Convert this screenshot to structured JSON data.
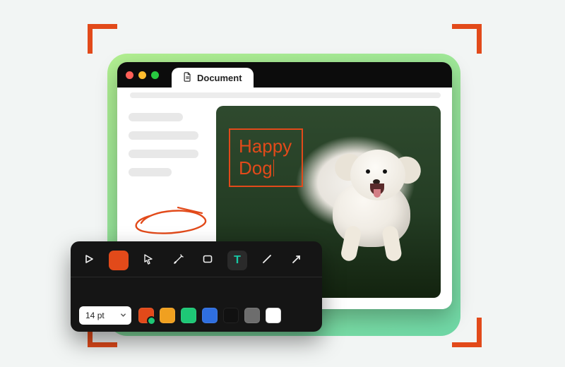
{
  "capture_corner_color": "#e24a1a",
  "window": {
    "tab_label": "Document",
    "traffic_colors": {
      "close": "#ff5f57",
      "min": "#febc2e",
      "max": "#28c840"
    }
  },
  "annotation": {
    "text_line1": "Happy",
    "text_line2": "Dog",
    "text_color": "#e24a1a"
  },
  "toolbar": {
    "tools": {
      "play": "play-icon",
      "record": "record-icon",
      "pointer": "pointer-icon",
      "brush": "brush-icon",
      "rect": "rectangle-icon",
      "text": "text-icon",
      "line": "line-icon",
      "arrow": "arrow-icon"
    },
    "active_tool": "text",
    "font_size_value": "14",
    "font_size_unit": "pt",
    "colors": [
      "#e24a1a",
      "#f0a020",
      "#1ec776",
      "#2f6fe0",
      "#111111",
      "#6d6d6d",
      "#ffffff"
    ],
    "selected_color": "#e24a1a"
  }
}
